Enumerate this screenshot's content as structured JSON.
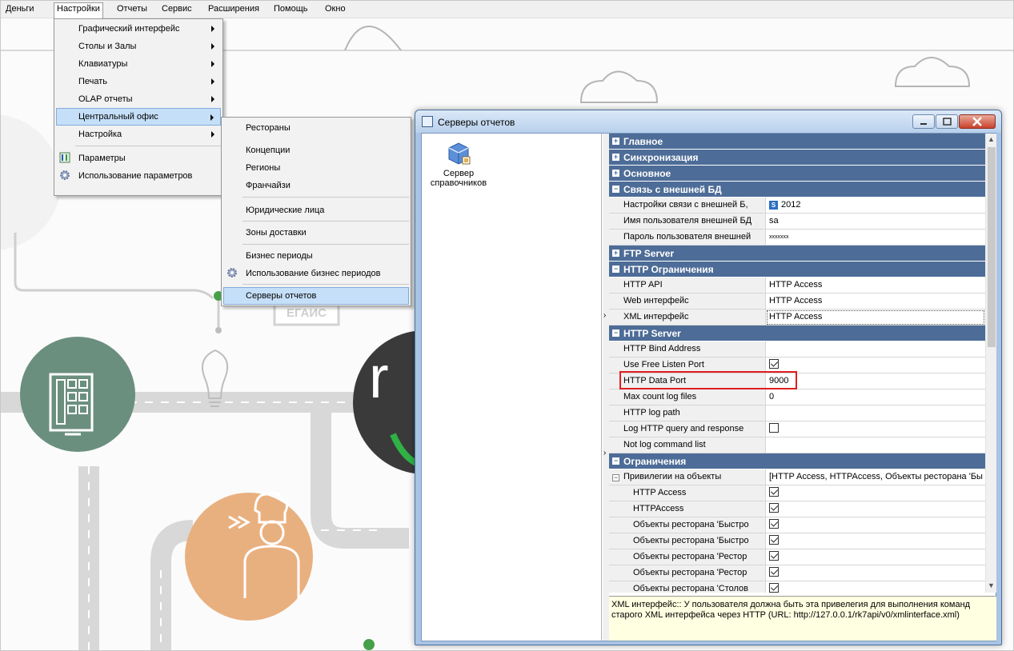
{
  "menubar": {
    "items": [
      "Деньги",
      "Настройки",
      "Отчеты",
      "Сервис",
      "Расширения",
      "Помощь",
      "Окно"
    ]
  },
  "settings_menu": {
    "items": [
      "Графический интерфейс",
      "Столы и Залы",
      "Клавиатуры",
      "Печать",
      "OLAP отчеты",
      "Центральный офис",
      "Настройка",
      "Параметры",
      "Использование параметров"
    ]
  },
  "central_office_menu": {
    "items": [
      "Рестораны",
      "Концепции",
      "Регионы",
      "Франчайзи",
      "Юридические лица",
      "Зоны доставки",
      "Бизнес периоды",
      "Использование бизнес периодов",
      "Серверы отчетов"
    ]
  },
  "background": {
    "egais_label": "ЕГАИС",
    "logo_letter": "r"
  },
  "window": {
    "title": "Серверы отчетов",
    "server_item_label": "Сервер справочников"
  },
  "grid": {
    "categories": {
      "main": "Главное",
      "sync": "Синхронизация",
      "basic": "Основное",
      "external_db": "Связь с внешней БД",
      "ftp": "FTP Server",
      "http_limits": "HTTP Ограничения",
      "http_server": "HTTP Server",
      "limits": "Ограничения"
    },
    "external_db": {
      "settings_label": "Настройки связи с внешней Б,",
      "settings_value": "2012",
      "sql_badge": "S",
      "user_label": "Имя пользователя внешней БД",
      "user_value": "sa",
      "password_label": "Пароль пользователя внешней",
      "password_value": "xxxxxxx"
    },
    "http_limits": {
      "api_label": "HTTP API",
      "api_value": "HTTP Access",
      "web_label": "Web интерфейс",
      "web_value": "HTTP Access",
      "xml_label": "XML интерфейс",
      "xml_value": "HTTP Access"
    },
    "http_server": {
      "bind_label": "HTTP Bind Address",
      "bind_value": "",
      "free_port_label": "Use Free Listen Port",
      "free_port_checked": true,
      "data_port_label": "HTTP Data Port",
      "data_port_value": "9000",
      "max_log_label": "Max count log files",
      "max_log_value": "0",
      "log_path_label": "HTTP log path",
      "log_path_value": "",
      "log_query_label": "Log HTTP query and response",
      "log_query_checked": false,
      "not_log_label": "Not log command list",
      "not_log_value": ""
    },
    "limits": {
      "priv_label": "Привилегии на объекты",
      "priv_value": "[HTTP Access, HTTPAccess, Объекты ресторана 'Бы",
      "sub_items": [
        "HTTP Access",
        "HTTPAccess",
        "Объекты ресторана 'Быстро",
        "Объекты ресторана 'Быстро",
        "Объекты ресторана 'Рестор",
        "Объекты ресторана 'Рестор",
        "Объекты ресторана 'Столов"
      ]
    }
  },
  "help": {
    "line1": "XML интерфейс:: У пользователя должна быть эта привелегия для выполнения команд",
    "line2": "старого XML интерфейса через HTTP (URL: http://127.0.0.1/rk7api/v0/xmlinterface.xml)"
  },
  "colors": {
    "category_bg": "#4d6c97",
    "highlight_menu": "#c5dff8",
    "red_box": "#e01e1e",
    "help_bg": "#ffffe1",
    "green_circle": "#6b8f7f",
    "orange_circle": "#e9b07f"
  }
}
